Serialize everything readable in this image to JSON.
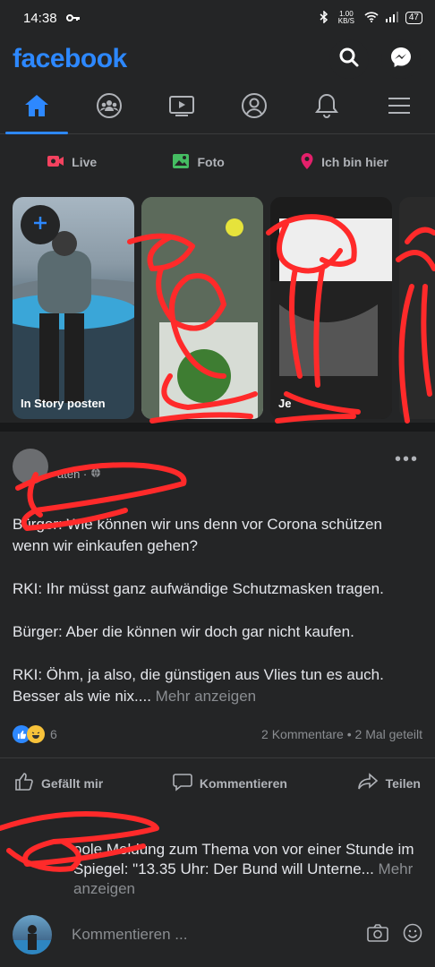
{
  "status": {
    "time": "14:38",
    "speed": "1.00 KB/S",
    "battery": "47"
  },
  "appbar": {
    "logo": "facebook",
    "icons": [
      "search-icon",
      "messenger-icon"
    ]
  },
  "tabs": [
    {
      "name": "home",
      "icon": "home-icon",
      "active": true
    },
    {
      "name": "groups",
      "icon": "groups-icon",
      "active": false
    },
    {
      "name": "watch",
      "icon": "watch-icon",
      "active": false
    },
    {
      "name": "profile",
      "icon": "profile-icon",
      "active": false
    },
    {
      "name": "notifications",
      "icon": "bell-icon",
      "active": false
    },
    {
      "name": "menu",
      "icon": "menu-icon",
      "active": false
    }
  ],
  "composer": {
    "live": "Live",
    "photo": "Foto",
    "checkin": "Ich bin hier"
  },
  "stories": [
    {
      "label": "In Story posten"
    },
    {
      "label": ""
    },
    {
      "label": "Je"
    },
    {
      "label": ""
    }
  ],
  "post": {
    "meta": "aten · ",
    "text": "Bürger: Wie können wir uns denn vor Corona schützen wenn wir einkaufen gehen?\n\nRKI: Ihr müsst ganz aufwändige Schutzmasken tragen.\n\nBürger: Aber die können wir doch gar nicht kaufen.\n\nRKI: Öhm, ja also, die günstigen aus Vlies tun es auch. Besser als wie nix.... ",
    "more": "Mehr anzeigen",
    "reaction_count": "6",
    "stats": "2 Kommentare • 2 Mal geteilt",
    "like": "Gefällt mir",
    "comment": "Kommentieren",
    "share": "Teilen"
  },
  "comment_preview": {
    "text": "oole Meldung zum Thema von vor einer Stunde im Spiegel: \"13.35 Uhr: Der Bund will Unterne... ",
    "more": "Mehr anzeigen"
  },
  "comment_bar": {
    "placeholder": "Kommentieren ..."
  },
  "colors": {
    "accent": "#2d88ff",
    "background": "#242526",
    "scribble": "#ff2a2a"
  }
}
